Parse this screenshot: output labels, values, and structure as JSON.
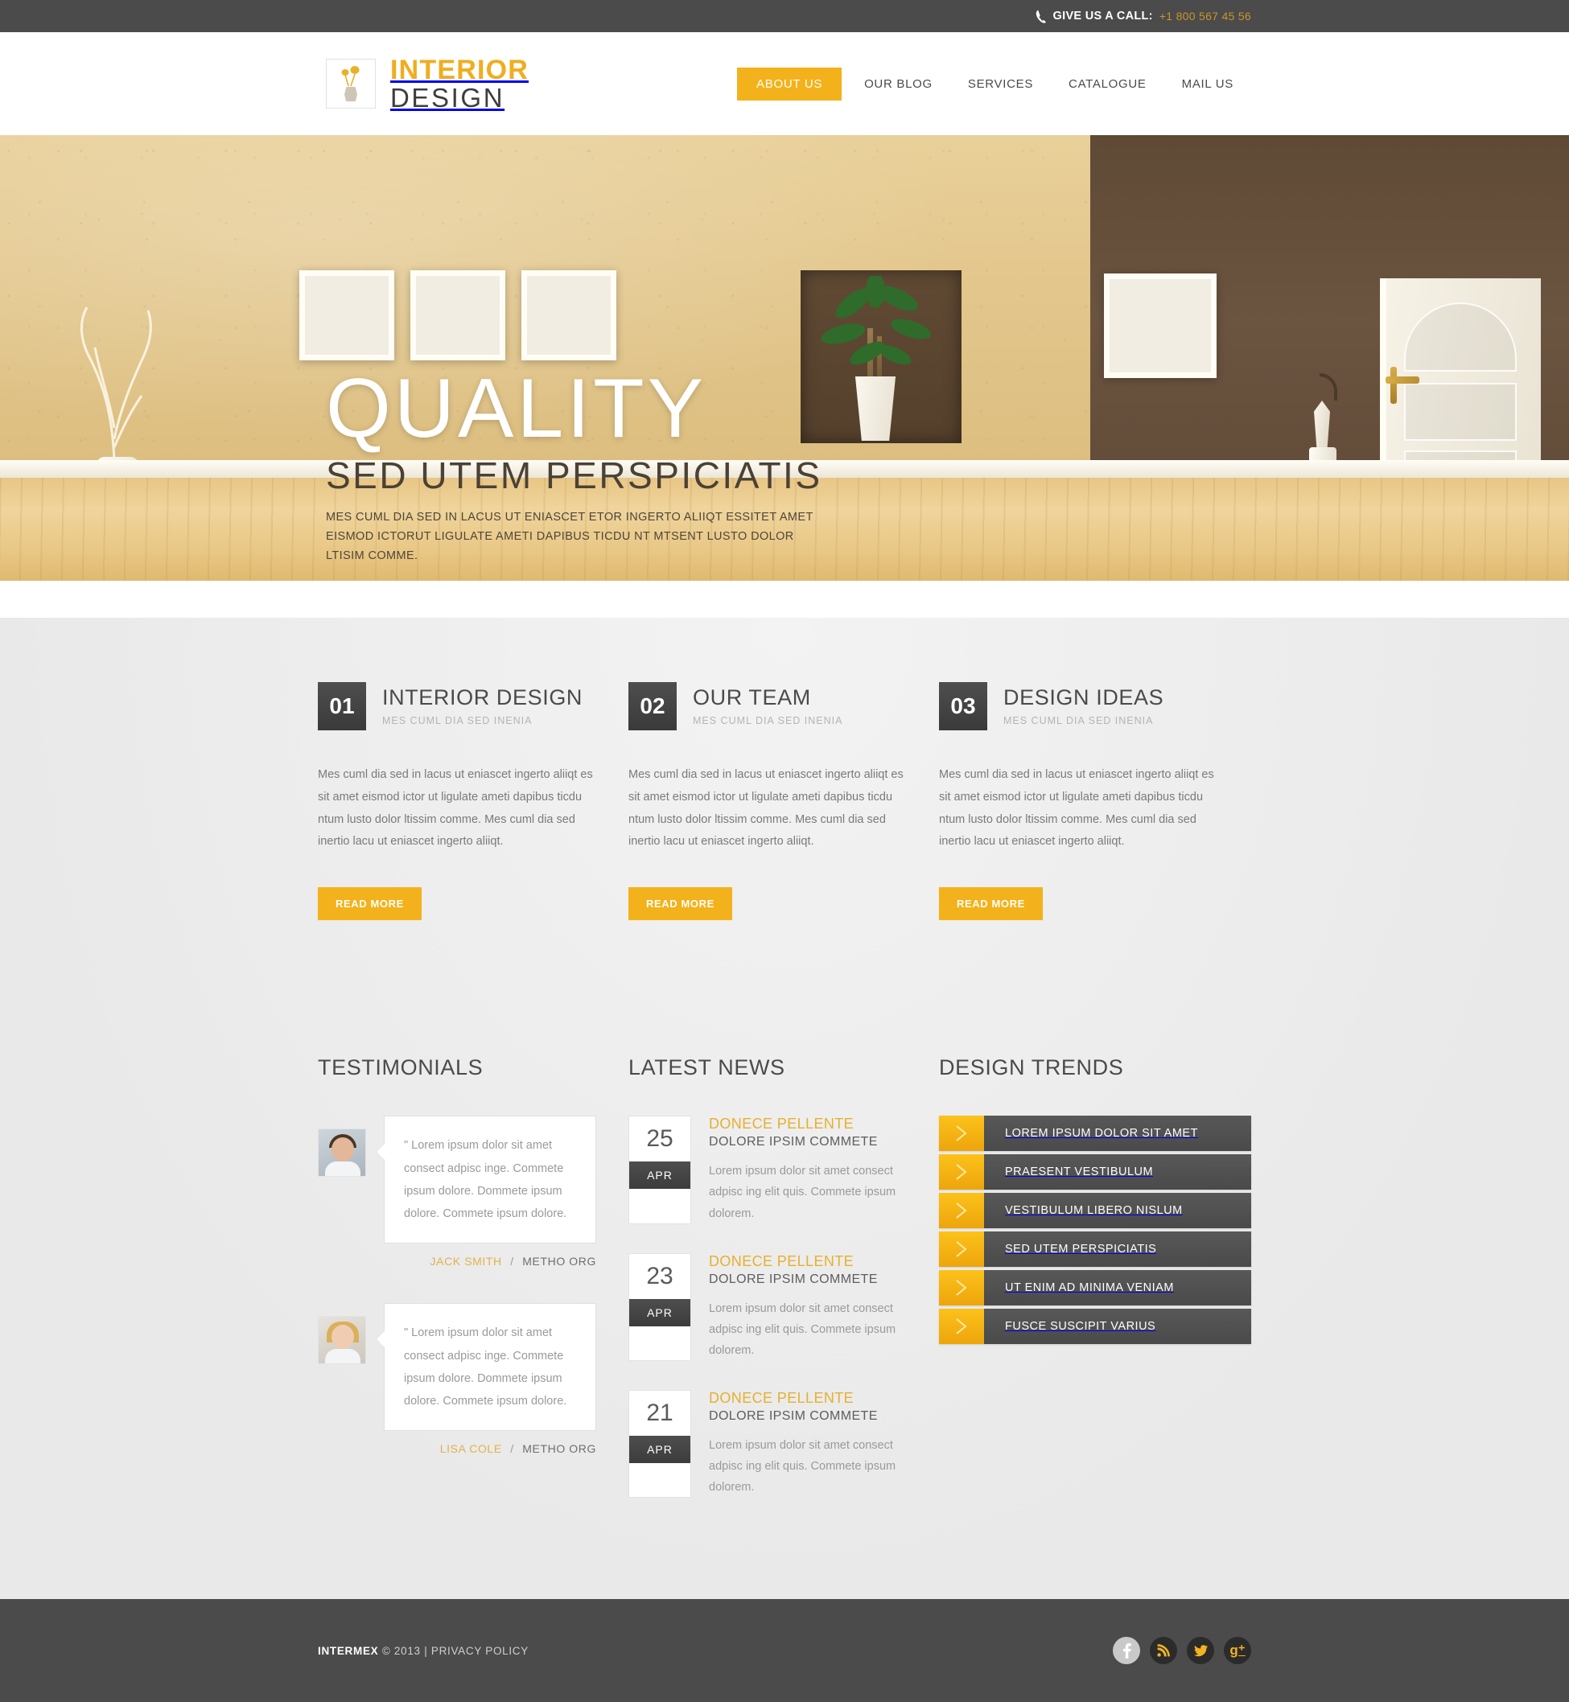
{
  "topbar": {
    "icon": "phone-icon",
    "call_label": "GIVE US A CALL:",
    "phone": "+1 800 567 45 56"
  },
  "header": {
    "logo": {
      "icon": "vase-with-flowers-icon",
      "line1": "INTERIOR",
      "line2": "DESIGN"
    },
    "nav": [
      {
        "label": "ABOUT US",
        "active": true
      },
      {
        "label": "OUR BLOG",
        "active": false
      },
      {
        "label": "SERVICES",
        "active": false
      },
      {
        "label": "CATALOGUE",
        "active": false
      },
      {
        "label": "MAIL US",
        "active": false
      }
    ]
  },
  "hero": {
    "title": "QUALITY",
    "subtitle": "SED UTEM PERSPICIATIS",
    "text": "MES CUML DIA SED IN LACUS UT ENIASCET ETOR INGERTO ALIIQT ESSITET AMET EISMOD ICTORUT LIGULATE AMETI DAPIBUS TICDU NT MTSENT LUSTO DOLOR LTISIM COMME.",
    "slides": [
      {
        "active": true
      },
      {
        "active": false
      },
      {
        "active": false
      }
    ]
  },
  "features": [
    {
      "number": "01",
      "title": "INTERIOR DESIGN",
      "subtitle": "MES CUML DIA SED INENIA",
      "body": "Mes cuml dia sed in lacus ut eniascet ingerto aliiqt es sit amet eismod ictor ut ligulate ameti dapibus ticdu ntum lusto dolor ltissim comme. Mes cuml dia sed inertio lacu ut eniascet ingerto aliiqt.",
      "button": "READ MORE"
    },
    {
      "number": "02",
      "title": "OUR TEAM",
      "subtitle": "MES CUML DIA SED INENIA",
      "body": "Mes cuml dia sed in lacus ut eniascet ingerto aliiqt es sit amet eismod ictor ut ligulate ameti dapibus ticdu ntum lusto dolor ltissim comme. Mes cuml dia sed inertio lacu ut eniascet ingerto aliiqt.",
      "button": "READ MORE"
    },
    {
      "number": "03",
      "title": "DESIGN IDEAS",
      "subtitle": "MES CUML DIA SED INENIA",
      "body": "Mes cuml dia sed in lacus ut eniascet ingerto aliiqt es sit amet eismod ictor ut ligulate ameti dapibus ticdu ntum lusto dolor ltissim comme. Mes cuml dia sed inertio lacu ut eniascet ingerto aliiqt.",
      "button": "READ MORE"
    }
  ],
  "testimonials": {
    "title": "TESTIMONIALS",
    "items": [
      {
        "avatar": "man-avatar",
        "quote": "\" Lorem ipsum dolor sit amet consect adpisc inge. Commete ipsum dolore. Dommete ipsum dolore. Commete ipsum dolore.",
        "name": "JACK SMITH",
        "separator": "/",
        "org": "METHO ORG"
      },
      {
        "avatar": "woman-avatar",
        "quote": "\" Lorem ipsum dolor sit amet consect adpisc inge. Commete ipsum dolore. Dommete ipsum dolore. Commete ipsum dolore.",
        "name": "LISA COLE",
        "separator": "/",
        "org": "METHO ORG"
      }
    ]
  },
  "news": {
    "title": "LATEST NEWS",
    "items": [
      {
        "day": "25",
        "month": "APR",
        "title": "DONECE PELLENTE",
        "subtitle": "DOLORE IPSIM COMMETE",
        "body": "Lorem ipsum dolor sit amet consect adpisc ing elit quis. Commete ipsum dolorem."
      },
      {
        "day": "23",
        "month": "APR",
        "title": "DONECE PELLENTE",
        "subtitle": "DOLORE IPSIM COMMETE",
        "body": "Lorem ipsum dolor sit amet consect adpisc ing elit quis. Commete ipsum dolorem."
      },
      {
        "day": "21",
        "month": "APR",
        "title": "DONECE PELLENTE",
        "subtitle": "DOLORE IPSIM COMMETE",
        "body": "Lorem ipsum dolor sit amet consect adpisc ing elit quis. Commete ipsum dolorem."
      }
    ]
  },
  "trends": {
    "title": "DESIGN TRENDS",
    "items": [
      {
        "label": "LOREM IPSUM DOLOR SIT AMET",
        "icon": "chevron-right-icon"
      },
      {
        "label": "PRAESENT VESTIBULUM",
        "icon": "chevron-right-icon"
      },
      {
        "label": "VESTIBULUM LIBERO NISLUM",
        "icon": "chevron-right-icon"
      },
      {
        "label": "SED UTEM PERSPICIATIS",
        "icon": "chevron-right-icon"
      },
      {
        "label": "UT ENIM AD MINIMA VENIAM",
        "icon": "chevron-right-icon"
      },
      {
        "label": "FUSCE SUSCIPIT VARIUS",
        "icon": "chevron-right-icon"
      }
    ]
  },
  "footer": {
    "brand": "INTERMEX",
    "copyright": "© 2013",
    "divider": "|",
    "privacy": "PRIVACY POLICY",
    "socials": [
      {
        "name": "facebook-icon",
        "glyph": "f"
      },
      {
        "name": "rss-icon",
        "glyph": "➶"
      },
      {
        "name": "twitter-icon",
        "glyph": "✉"
      },
      {
        "name": "google-plus-icon",
        "glyph": "g⁺"
      }
    ]
  },
  "colors": {
    "accent": "#f3b21b",
    "dark": "#4b4b4b",
    "text": "#7a7a7a"
  }
}
